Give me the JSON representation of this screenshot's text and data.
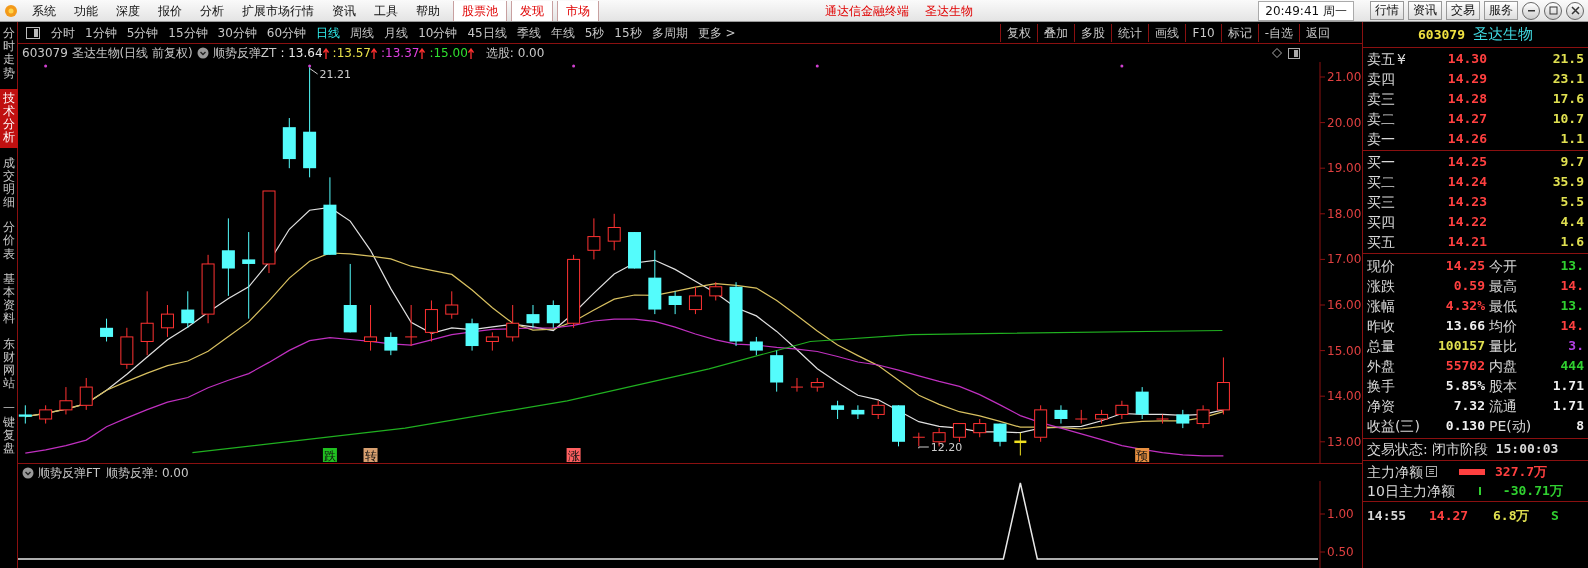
{
  "menu_bar": {
    "items": [
      "系统",
      "功能",
      "深度",
      "报价",
      "分析",
      "扩展市场行情",
      "资讯",
      "工具",
      "帮助"
    ],
    "boxed_items": [
      "股票池",
      "发现",
      "市场"
    ],
    "title_parts": [
      "通达信金融终端",
      "圣达生物"
    ],
    "clock": "20:49:41 周一",
    "buttons": [
      "行情",
      "资讯",
      "交易",
      "服务"
    ]
  },
  "side_tabs": [
    {
      "label": "分时走势",
      "selected": false
    },
    {
      "label": "技术分析",
      "selected": true
    },
    {
      "label": "成交明细",
      "selected": false
    },
    {
      "label": "分价表",
      "selected": false
    },
    {
      "label": "基本资料",
      "selected": false
    },
    {
      "label": "东财网站",
      "selected": false
    },
    {
      "label": "一键复盘",
      "selected": false
    }
  ],
  "period_tabs": [
    {
      "label": "分时",
      "selected": false
    },
    {
      "label": "1分钟",
      "selected": false
    },
    {
      "label": "5分钟",
      "selected": false
    },
    {
      "label": "15分钟",
      "selected": false
    },
    {
      "label": "30分钟",
      "selected": false
    },
    {
      "label": "60分钟",
      "selected": false
    },
    {
      "label": "日线",
      "selected": true
    },
    {
      "label": "周线",
      "selected": false
    },
    {
      "label": "月线",
      "selected": false
    },
    {
      "label": "10分钟",
      "selected": false
    },
    {
      "label": "45日线",
      "selected": false
    },
    {
      "label": "季线",
      "selected": false
    },
    {
      "label": "年线",
      "selected": false
    },
    {
      "label": "5秒",
      "selected": false
    },
    {
      "label": "15秒",
      "selected": false
    },
    {
      "label": "多周期",
      "selected": false
    },
    {
      "label": "更多 >",
      "selected": false
    }
  ],
  "tools": [
    "复权",
    "叠加",
    "多股",
    "统计",
    "画线",
    "F10",
    "标记",
    "-自选",
    "返回"
  ],
  "chart_header": {
    "title": "603079 圣达生物(日线 前复权)",
    "indicator": "顺势反弹ZT",
    "values": [
      {
        "text": ": 13.64",
        "color": "#e8e8e8"
      },
      {
        "text": ":13.57",
        "color": "#e8e04a"
      },
      {
        "text": ":13.37",
        "color": "#e040e0"
      },
      {
        "text": ":15.00",
        "color": "#30e030"
      }
    ],
    "extra": "选股: 0.00"
  },
  "price_axis": [
    "21.00",
    "20.00",
    "19.00",
    "18.00",
    "17.00",
    "16.00",
    "15.00",
    "14.00",
    "13.00"
  ],
  "annotations": [
    "21.21",
    "12.20"
  ],
  "signals": [
    {
      "text": "跌",
      "color": "#20c020"
    },
    {
      "text": "转",
      "color": "#d8a070"
    },
    {
      "text": "涨",
      "color": "#ff6060"
    },
    {
      "text": "预",
      "color": "#e89040"
    }
  ],
  "lower_panel": {
    "title": "顺势反弹FT",
    "value": "顺势反弹: 0.00",
    "axis": [
      "1.00",
      "0.50"
    ]
  },
  "quote": {
    "code": "603079",
    "name": "圣达生物",
    "asks": [
      {
        "label": "卖五",
        "mark": "¥",
        "price": "14.30",
        "volume": "21.5"
      },
      {
        "label": "卖四",
        "price": "14.29",
        "volume": "23.1"
      },
      {
        "label": "卖三",
        "price": "14.28",
        "volume": "17.6"
      },
      {
        "label": "卖二",
        "price": "14.27",
        "volume": "10.7"
      },
      {
        "label": "卖一",
        "price": "14.26",
        "volume": "1.1"
      }
    ],
    "bids": [
      {
        "label": "买一",
        "price": "14.25",
        "volume": "9.7"
      },
      {
        "label": "买二",
        "price": "14.24",
        "volume": "35.9"
      },
      {
        "label": "买三",
        "price": "14.23",
        "volume": "5.5"
      },
      {
        "label": "买四",
        "price": "14.22",
        "volume": "4.4"
      },
      {
        "label": "买五",
        "price": "14.21",
        "volume": "1.6"
      }
    ],
    "stats": [
      {
        "left": {
          "label": "现价",
          "value": "14.25",
          "color": "#ff4040"
        },
        "right": {
          "label": "今开",
          "value": "13.",
          "color": "#30d030"
        }
      },
      {
        "left": {
          "label": "涨跌",
          "value": "0.59",
          "color": "#ff4040"
        },
        "right": {
          "label": "最高",
          "value": "14.",
          "color": "#ff4040"
        }
      },
      {
        "left": {
          "label": "涨幅",
          "value": "4.32%",
          "color": "#ff4040"
        },
        "right": {
          "label": "最低",
          "value": "13.",
          "color": "#30d030"
        }
      },
      {
        "left": {
          "label": "昨收",
          "value": "13.66",
          "color": "#f0f0f0"
        },
        "right": {
          "label": "均价",
          "value": "14.",
          "color": "#ff4040"
        }
      },
      {
        "left": {
          "label": "总量",
          "value": "100157",
          "color": "#e0e050"
        },
        "right": {
          "label": "量比",
          "value": "3.",
          "color": "#b040e0"
        }
      },
      {
        "left": {
          "label": "外盘",
          "value": "55702",
          "color": "#ff4040"
        },
        "right": {
          "label": "内盘",
          "value": "444",
          "color": "#30d030"
        }
      },
      {
        "left": {
          "label": "换手",
          "value": "5.85%",
          "color": "#f0f0f0"
        },
        "right": {
          "label": "股本",
          "value": "1.71",
          "color": "#f0f0f0"
        }
      },
      {
        "left": {
          "label": "净资",
          "value": "7.32",
          "color": "#f0f0f0"
        },
        "right": {
          "label": "流通",
          "value": "1.71",
          "color": "#f0f0f0"
        }
      },
      {
        "left": {
          "label": "收益(三)",
          "value": "0.130",
          "color": "#f0f0f0"
        },
        "right": {
          "label": "PE(动)",
          "value": "8",
          "color": "#f0f0f0"
        }
      }
    ],
    "status": {
      "label": "交易状态:",
      "phase": "闭市阶段",
      "time": "15:00:03"
    },
    "flows": [
      {
        "label": "主力净额",
        "value": "327.7万",
        "color": "#ff4040"
      },
      {
        "label": "10日主力净额",
        "value": "-30.71万",
        "color": "#30d030"
      }
    ],
    "tick": {
      "time": "14:55",
      "price": "14.27",
      "volume": "6.8万",
      "side": "S"
    }
  }
}
